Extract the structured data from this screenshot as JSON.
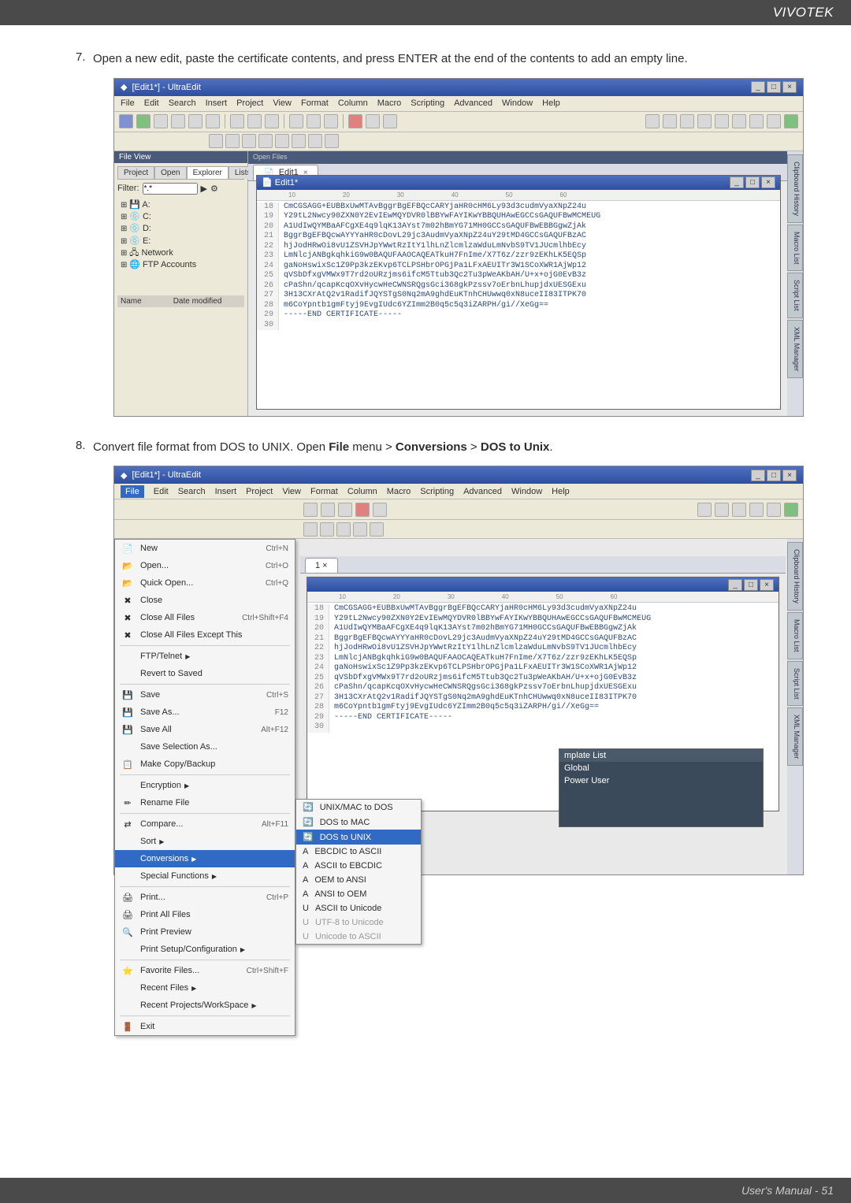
{
  "brand": "VIVOTEK",
  "footer": "User's Manual - 51",
  "step7": {
    "num": "7.",
    "text_a": "Open a new edit, paste the certificate contents, and press ENTER at the end of the contents to add an empty line."
  },
  "step8": {
    "num": "8.",
    "text_a": "Convert file format from DOS to UNIX. Open ",
    "b1": "File",
    "m1": " menu > ",
    "b2": "Conversions",
    "m2": " > ",
    "b3": "DOS to Unix",
    "p": "."
  },
  "shot_title": "[Edit1*] - UltraEdit",
  "menubar": [
    "File",
    "Edit",
    "Search",
    "Insert",
    "Project",
    "View",
    "Format",
    "Column",
    "Macro",
    "Scripting",
    "Advanced",
    "Window",
    "Help"
  ],
  "sidebar": {
    "tabs": [
      "Project",
      "Open",
      "Explorer",
      "Lists"
    ],
    "filter": "Filter:",
    "filter_val": "*.*",
    "tree": [
      "A:",
      "C:",
      "D:",
      "E:",
      "Network",
      "FTP Accounts"
    ],
    "cols": [
      "Name",
      "Date modified"
    ]
  },
  "rside": [
    "Clipboard History",
    "Macro List",
    "Script List",
    "XML Manager"
  ],
  "tab_name": "Edit1",
  "inner_title": "Edit1*",
  "ruler": [
    "10",
    "20",
    "30",
    "40",
    "50",
    "60"
  ],
  "cert_lines": [
    {
      "n": "18",
      "t": "CmCGSAGG+EUBBxUwMTAvBggrBgEFBQcCARYjaHR0cHM6Ly93d3cudmVyaXNpZ24u"
    },
    {
      "n": "19",
      "t": "Y29tL2Nwcy90ZXN0Y2EvIEwMQYDVR0lBBYwFAYIKwYBBQUHAwEGCCsGAQUFBwMCMEUG"
    },
    {
      "n": "20",
      "t": "A1UdIwQYMBaAFCgXE4q9lqK13AYst7m02hBmYG71MH0GCCsGAQUFBwEBBGgwZjAk"
    },
    {
      "n": "21",
      "t": "BggrBgEFBQcwAYYYaHR0cDovL29jc3AudmVyaXNpZ24uY29tMD4GCCsGAQUFBzAC"
    },
    {
      "n": "22",
      "t": "hjJodHRwOi8vU1ZSVHJpYWwtRzItY1lhLnZlcmlzaWduLmNvbS9TV1JUcmlhbEcy"
    },
    {
      "n": "23",
      "t": "LmNlcjANBgkqhkiG9w0BAQUFAAOCAQEATkuH7FnIme/X7T6z/zzr9zEKhLK5EQSp"
    },
    {
      "n": "24",
      "t": "gaNoHswixSc1Z9Pp3kzEKvp6TCLPSHbrOPGjPa1LFxAEUITr3W1SCoXWR1AjWp12"
    },
    {
      "n": "25",
      "t": "qVSbDfxgVMWx9T7rd2oURzjms6ifcM5Ttub3Qc2Tu3pWeAKbAH/U+x+ojG0EvB3z"
    },
    {
      "n": "26",
      "t": "cPaShn/qcapKcqOXvHycwHeCWNSRQgsGci368gkPzssv7oErbnLhupjdxUESGExu"
    },
    {
      "n": "27",
      "t": "3H13CXrAtQ2v1RadifJQYSTgS0Nq2mA9ghdEuKTnhCHUwwq0xN8uceII83ITPK70"
    },
    {
      "n": "28",
      "t": "m6CoYpntb1gmFtyj9EvgIUdc6YZImm2B0q5c5q3iZARPH/gi//XeGg=="
    },
    {
      "n": "29",
      "t": "-----END CERTIFICATE-----"
    },
    {
      "n": "30",
      "t": ""
    }
  ],
  "filemenu": [
    {
      "lbl": "New",
      "sc": "Ctrl+N",
      "ic": "📄"
    },
    {
      "lbl": "Open...",
      "sc": "Ctrl+O",
      "ic": "📂"
    },
    {
      "lbl": "Quick Open...",
      "sc": "Ctrl+Q",
      "ic": "📂"
    },
    {
      "lbl": "Close",
      "sc": "",
      "ic": "✖"
    },
    {
      "lbl": "Close All Files",
      "sc": "Ctrl+Shift+F4",
      "ic": "✖"
    },
    {
      "lbl": "Close All Files Except This",
      "sc": "",
      "ic": "✖"
    },
    {
      "sep": true
    },
    {
      "lbl": "FTP/Telnet",
      "sc": "",
      "ic": "",
      "arrow": true
    },
    {
      "lbl": "Revert to Saved",
      "sc": "",
      "ic": "",
      "dis": true
    },
    {
      "sep": true
    },
    {
      "lbl": "Save",
      "sc": "Ctrl+S",
      "ic": "💾"
    },
    {
      "lbl": "Save As...",
      "sc": "F12",
      "ic": "💾"
    },
    {
      "lbl": "Save All",
      "sc": "Alt+F12",
      "ic": "💾"
    },
    {
      "lbl": "Save Selection As...",
      "sc": "",
      "ic": "",
      "dis": true
    },
    {
      "lbl": "Make Copy/Backup",
      "sc": "",
      "ic": "📋"
    },
    {
      "sep": true
    },
    {
      "lbl": "Encryption",
      "sc": "",
      "ic": "",
      "arrow": true
    },
    {
      "lbl": "Rename File",
      "sc": "",
      "ic": "✏"
    },
    {
      "sep": true
    },
    {
      "lbl": "Compare...",
      "sc": "Alt+F11",
      "ic": "⇄"
    },
    {
      "lbl": "Sort",
      "sc": "",
      "ic": "",
      "arrow": true
    },
    {
      "lbl": "Conversions",
      "sc": "",
      "ic": "",
      "arrow": true,
      "hov": true
    },
    {
      "lbl": "Special Functions",
      "sc": "",
      "ic": "",
      "arrow": true
    },
    {
      "sep": true
    },
    {
      "lbl": "Print...",
      "sc": "Ctrl+P",
      "ic": "🖨"
    },
    {
      "lbl": "Print All Files",
      "sc": "",
      "ic": "🖨"
    },
    {
      "lbl": "Print Preview",
      "sc": "",
      "ic": "🔍"
    },
    {
      "lbl": "Print Setup/Configuration",
      "sc": "",
      "ic": "",
      "arrow": true
    },
    {
      "sep": true
    },
    {
      "lbl": "Favorite Files...",
      "sc": "Ctrl+Shift+F",
      "ic": "⭐"
    },
    {
      "lbl": "Recent Files",
      "sc": "",
      "ic": "",
      "arrow": true
    },
    {
      "lbl": "Recent Projects/WorkSpace",
      "sc": "",
      "ic": "",
      "arrow": true
    },
    {
      "sep": true
    },
    {
      "lbl": "Exit",
      "sc": "",
      "ic": "🚪"
    }
  ],
  "submenu": [
    {
      "lbl": "UNIX/MAC to DOS",
      "ic": "🔄"
    },
    {
      "lbl": "DOS to MAC",
      "ic": "🔄"
    },
    {
      "lbl": "DOS to UNIX",
      "ic": "🔄",
      "hov": true
    },
    {
      "lbl": "EBCDIC to ASCII",
      "ic": "A"
    },
    {
      "lbl": "ASCII to EBCDIC",
      "ic": "A"
    },
    {
      "lbl": "OEM to ANSI",
      "ic": "A"
    },
    {
      "lbl": "ANSI to OEM",
      "ic": "A"
    },
    {
      "lbl": "ASCII to Unicode",
      "ic": "U"
    },
    {
      "lbl": "UTF-8 to Unicode",
      "ic": "U",
      "dis": true
    },
    {
      "lbl": "Unicode to ASCII",
      "ic": "U",
      "dis": true
    }
  ],
  "template": {
    "head": "mplate List",
    "row1": "Global",
    "row2": "Power User"
  },
  "editor2_top": {
    "n": "1",
    "t": "1  ×"
  },
  "pane_head": "Open Files",
  "file_view": "File View"
}
